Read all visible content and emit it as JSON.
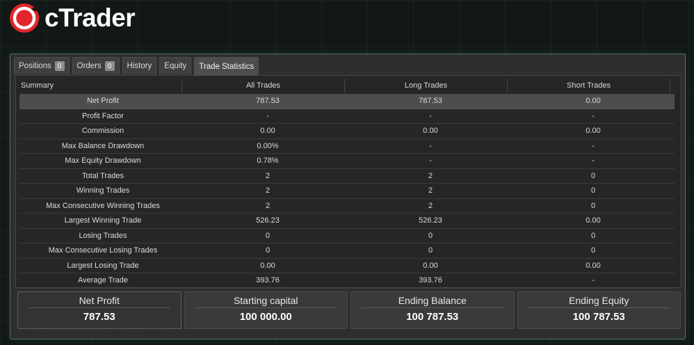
{
  "brand": {
    "name": "cTrader",
    "accent": "#e3262b"
  },
  "tabs": [
    {
      "label": "Positions",
      "badge": "0"
    },
    {
      "label": "Orders",
      "badge": "0"
    },
    {
      "label": "History"
    },
    {
      "label": "Equity"
    },
    {
      "label": "Trade Statistics"
    }
  ],
  "table": {
    "headers": [
      "Summary",
      "All Trades",
      "Long Trades",
      "Short Trades"
    ],
    "rows": [
      [
        "Net Profit",
        "787.53",
        "787.53",
        "0.00"
      ],
      [
        "Profit Factor",
        "-",
        "-",
        "-"
      ],
      [
        "Commission",
        "0.00",
        "0.00",
        "0.00"
      ],
      [
        "Max Balance Drawdown",
        "0.00%",
        "-",
        "-"
      ],
      [
        "Max Equity Drawdown",
        "0.78%",
        "-",
        "-"
      ],
      [
        "Total Trades",
        "2",
        "2",
        "0"
      ],
      [
        "Winning Trades",
        "2",
        "2",
        "0"
      ],
      [
        "Max Consecutive Winning Trades",
        "2",
        "2",
        "0"
      ],
      [
        "Largest Winning Trade",
        "526.23",
        "526.23",
        "0.00"
      ],
      [
        "Losing Trades",
        "0",
        "0",
        "0"
      ],
      [
        "Max Consecutive Losing Trades",
        "0",
        "0",
        "0"
      ],
      [
        "Largest Losing Trade",
        "0.00",
        "0.00",
        "0.00"
      ],
      [
        "Average Trade",
        "393.76",
        "393.76",
        "-"
      ]
    ]
  },
  "cards": [
    {
      "title": "Net Profit",
      "value": "787.53"
    },
    {
      "title": "Starting capital",
      "value": "100 000.00"
    },
    {
      "title": "Ending Balance",
      "value": "100 787.53"
    },
    {
      "title": "Ending Equity",
      "value": "100 787.53"
    }
  ]
}
